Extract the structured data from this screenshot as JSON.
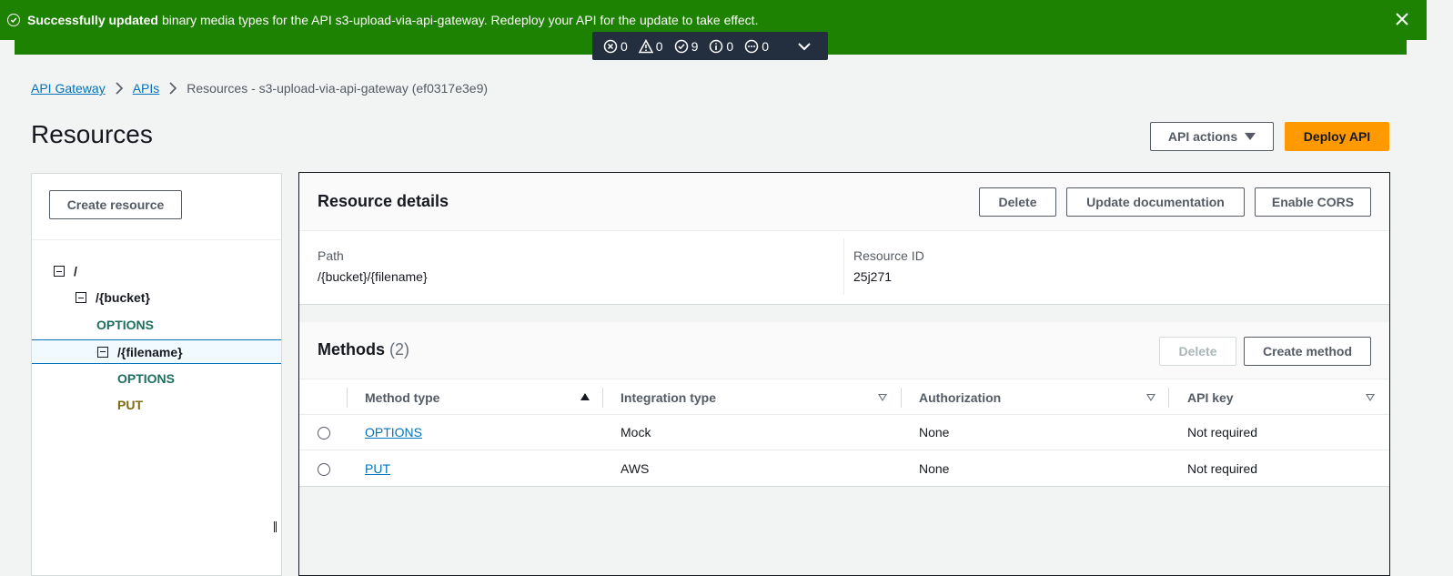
{
  "flash": {
    "strong": "Successfully updated",
    "message": "binary media types for the API s3-upload-via-api-gateway. Redeploy your API for the update to take effect."
  },
  "counters": {
    "errors": "0",
    "warnings": "0",
    "success": "9",
    "info": "0",
    "pending": "0"
  },
  "breadcrumbs": {
    "items": [
      "API Gateway",
      "APIs"
    ],
    "current": "Resources - s3-upload-via-api-gateway (ef0317e3e9)"
  },
  "page": {
    "title": "Resources",
    "api_actions_label": "API actions",
    "deploy_label": "Deploy API"
  },
  "tree": {
    "create_resource_label": "Create resource",
    "nodes": [
      {
        "label": "/"
      },
      {
        "label": "/{bucket}"
      },
      {
        "label": "OPTIONS"
      },
      {
        "label": "/{filename}"
      },
      {
        "label": "OPTIONS"
      },
      {
        "label": "PUT"
      }
    ]
  },
  "details": {
    "title": "Resource details",
    "delete_label": "Delete",
    "update_doc_label": "Update documentation",
    "enable_cors_label": "Enable CORS",
    "path_label": "Path",
    "path_value": "/{bucket}/{filename}",
    "resource_id_label": "Resource ID",
    "resource_id_value": "25j271"
  },
  "methods": {
    "title": "Methods",
    "count": "(2)",
    "delete_label": "Delete",
    "create_label": "Create method",
    "columns": [
      "Method type",
      "Integration type",
      "Authorization",
      "API key"
    ],
    "rows": [
      {
        "method": "OPTIONS",
        "integration": "Mock",
        "authorization": "None",
        "api_key": "Not required"
      },
      {
        "method": "PUT",
        "integration": "AWS",
        "authorization": "None",
        "api_key": "Not required"
      }
    ]
  },
  "colors": {
    "success": "#1d8102",
    "primary": "#ff9900",
    "link": "#0073bb"
  }
}
